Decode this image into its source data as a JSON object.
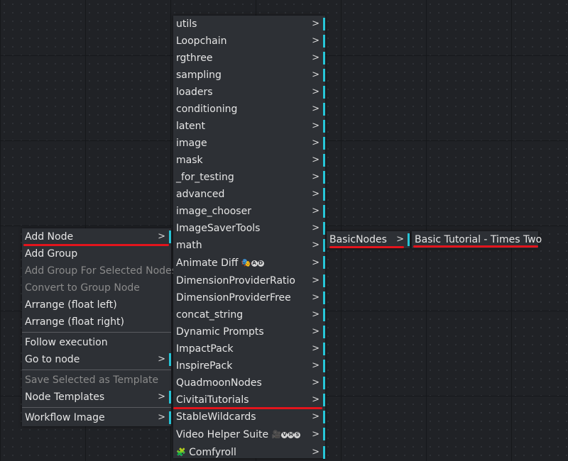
{
  "context_menu": {
    "groups": [
      [
        {
          "label": "Add Node",
          "submenu": true
        },
        {
          "label": "Add Group"
        },
        {
          "label": "Add Group For Selected Nodes",
          "disabled": true
        },
        {
          "label": "Convert to Group Node",
          "disabled": true
        },
        {
          "label": "Arrange (float left)"
        },
        {
          "label": "Arrange (float right)"
        }
      ],
      [
        {
          "label": "Follow execution"
        },
        {
          "label": "Go to node",
          "submenu": true
        }
      ],
      [
        {
          "label": "Save Selected as Template",
          "disabled": true
        },
        {
          "label": "Node Templates",
          "submenu": true
        }
      ],
      [
        {
          "label": "Workflow Image",
          "submenu": true
        }
      ]
    ]
  },
  "category_menu": {
    "items": [
      {
        "label": "utils"
      },
      {
        "label": "Loopchain"
      },
      {
        "label": "rgthree"
      },
      {
        "label": "sampling"
      },
      {
        "label": "loaders"
      },
      {
        "label": "conditioning"
      },
      {
        "label": "latent"
      },
      {
        "label": "image"
      },
      {
        "label": "mask"
      },
      {
        "label": "_for_testing"
      },
      {
        "label": "advanced"
      },
      {
        "label": "image_chooser"
      },
      {
        "label": "ImageSaverTools"
      },
      {
        "label": "math"
      },
      {
        "label": "Animate Diff"
      },
      {
        "label": "DimensionProviderRatio"
      },
      {
        "label": "DimensionProviderFree"
      },
      {
        "label": "concat_string"
      },
      {
        "label": "Dynamic Prompts"
      },
      {
        "label": "ImpactPack"
      },
      {
        "label": "InspirePack"
      },
      {
        "label": "QuadmoonNodes"
      },
      {
        "label": "CivitaiTutorials"
      },
      {
        "label": "StableWildcards"
      },
      {
        "label": "Video Helper Suite"
      },
      {
        "label": "Comfyroll"
      }
    ],
    "animate_diff_badges": [
      "A",
      "D"
    ],
    "video_helper_badges": [
      "V",
      "H",
      "S"
    ],
    "icons": {
      "animate_diff": "mask-icon",
      "video_helper": "film-camera-icon",
      "comfyroll": "puzzle-piece-icon"
    }
  },
  "basicnodes_menu": {
    "label": "BasicNodes"
  },
  "leaf_menu": {
    "label": "Basic Tutorial - Times Two"
  },
  "arrow_glyph": ">",
  "colors": {
    "accent": "#27c6d8",
    "highlight": "#e3141c",
    "menu_bg": "#2d3035",
    "canvas_bg": "#202226"
  }
}
